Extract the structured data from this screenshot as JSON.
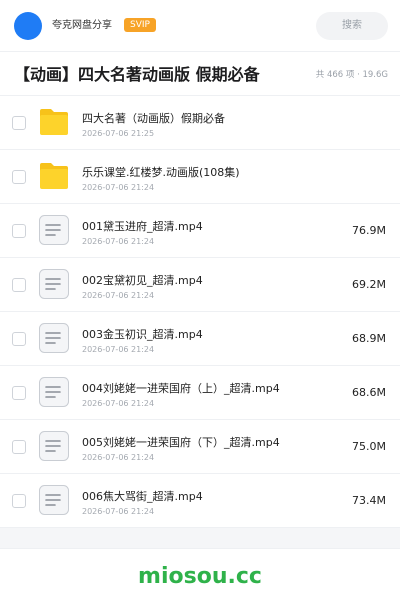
{
  "header": {
    "share_name": "夸克网盘分享",
    "badge": "SVIP",
    "search_label": "搜索",
    "avatar_color": "#1f7cf5",
    "badge_color": "#f7a327"
  },
  "folder": {
    "title": "【动画】四大名著动画版 假期必备",
    "meta": "共 466 项 · 19.6G"
  },
  "items": [
    {
      "name": "四大名著（动画版）假期必备",
      "date": "2026-07-06 21:25",
      "size": "",
      "type": "folder-icon"
    },
    {
      "name": "乐乐课堂.红楼梦.动画版(108集)",
      "date": "2026-07-06 21:24",
      "size": "",
      "type": "folder-icon"
    },
    {
      "name": "001黛玉进府_超清.mp4",
      "date": "2026-07-06 21:24",
      "size": "76.9M",
      "type": "video-file-icon"
    },
    {
      "name": "002宝黛初见_超清.mp4",
      "date": "2026-07-06 21:24",
      "size": "69.2M",
      "type": "video-file-icon"
    },
    {
      "name": "003金玉初识_超清.mp4",
      "date": "2026-07-06 21:24",
      "size": "68.9M",
      "type": "video-file-icon"
    },
    {
      "name": "004刘姥姥一进荣国府（上）_超清.mp4",
      "date": "2026-07-06 21:24",
      "size": "68.6M",
      "type": "video-file-icon"
    },
    {
      "name": "005刘姥姥一进荣国府（下）_超清.mp4",
      "date": "2026-07-06 21:24",
      "size": "75.0M",
      "type": "video-file-icon"
    },
    {
      "name": "006焦大骂街_超清.mp4",
      "date": "2026-07-06 21:24",
      "size": "73.4M",
      "type": "video-file-icon"
    }
  ],
  "watermark": {
    "text": "miosou.cc",
    "color": "#2fb24a"
  }
}
